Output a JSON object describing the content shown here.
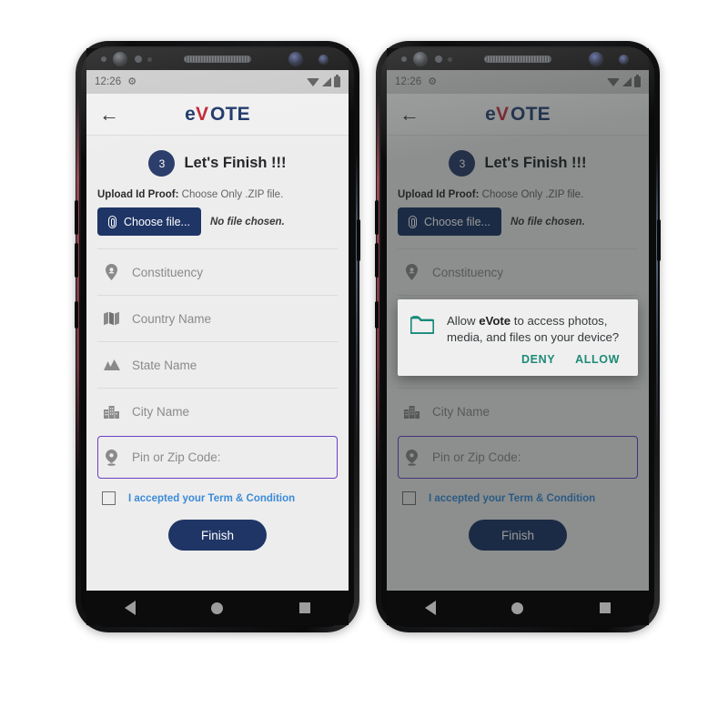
{
  "statusbar": {
    "time": "12:26",
    "gear_icon": "gear-icon",
    "wifi_icon": "wifi-icon",
    "signal_icon": "signal-icon",
    "battery_icon": "battery-icon"
  },
  "appbar": {
    "back_icon": "back-arrow-icon",
    "logo_prefix": "e",
    "logo_mark": "V",
    "logo_suffix": "OTE"
  },
  "step": {
    "number": "3",
    "title": "Let's Finish !!!"
  },
  "upload": {
    "label_bold": "Upload Id Proof:",
    "label_rest": " Choose Only .ZIP file.",
    "button_label": "Choose file...",
    "clip_icon": "paperclip-icon",
    "status": "No file chosen."
  },
  "fields": [
    {
      "label": "Constituency",
      "icon": "location-person-icon"
    },
    {
      "label": "Country Name",
      "icon": "map-icon"
    },
    {
      "label": "State Name",
      "icon": "mountains-icon"
    },
    {
      "label": "City Name",
      "icon": "city-buildings-icon"
    },
    {
      "label": "Pin or Zip Code:",
      "icon": "map-pin-icon",
      "focused": true
    }
  ],
  "terms": {
    "checkbox_checked": false,
    "text": "I accepted your Term & Condition"
  },
  "submit": {
    "label": "Finish"
  },
  "navbar": {
    "back_icon": "nav-back-icon",
    "home_icon": "nav-home-icon",
    "recents_icon": "nav-recents-icon"
  },
  "permission_dialog": {
    "folder_icon": "folder-icon",
    "message_pre": "Allow ",
    "message_app": "eVote",
    "message_post": " to access photos, media, and files on your device?",
    "deny_label": "DENY",
    "allow_label": "ALLOW"
  },
  "colors": {
    "navy": "#1f3566",
    "badge_navy": "#2c3e6b",
    "logo_red": "#c02030",
    "link_blue": "#3c8bd9",
    "focus_purple": "#6c3fc4",
    "teal": "#1f8a76",
    "screen_bg": "#ededed",
    "statusbar_bg": "#c9c9c9"
  }
}
